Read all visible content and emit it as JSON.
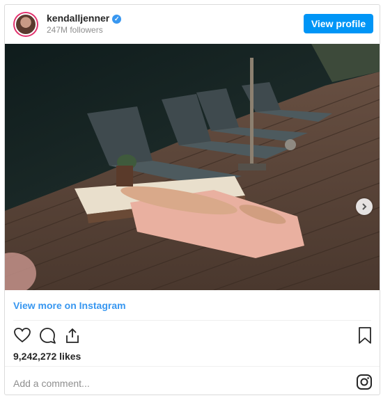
{
  "header": {
    "username": "kendalljenner",
    "verified_icon": "verified-badge-icon",
    "followers": "247M followers",
    "view_profile_label": "View profile"
  },
  "media": {
    "carousel_count": 5,
    "active_index": 0
  },
  "footer": {
    "view_more_label": "View more on Instagram",
    "likes": "9,242,272 likes",
    "comment_placeholder": "Add a comment...",
    "icons": [
      "heart-icon",
      "comment-icon",
      "share-icon",
      "bookmark-icon",
      "instagram-logo-icon"
    ]
  },
  "colors": {
    "accent": "#0095f6",
    "link": "#3897f0"
  }
}
